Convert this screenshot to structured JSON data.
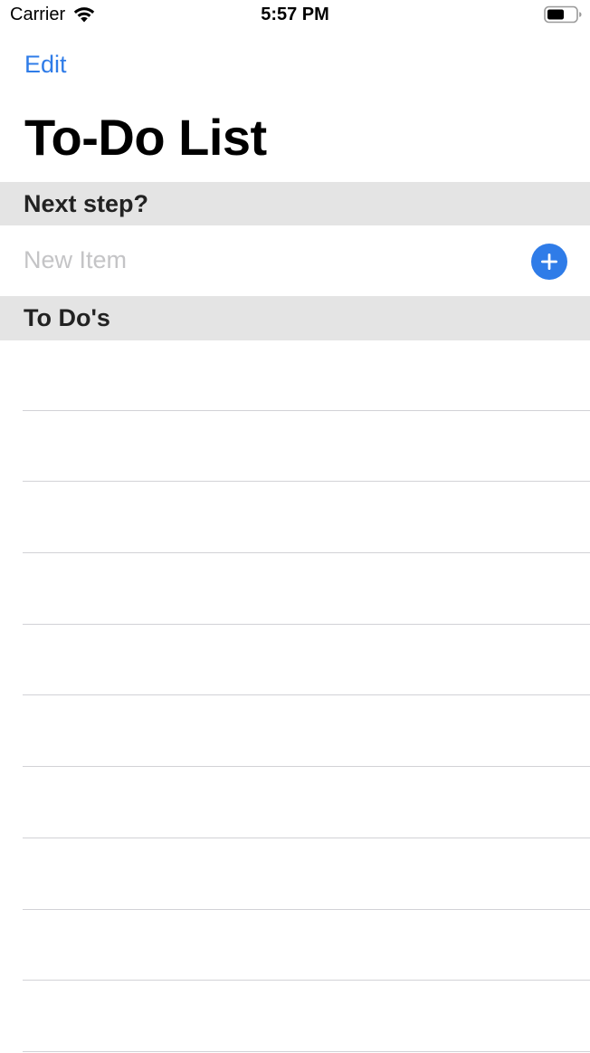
{
  "status_bar": {
    "carrier": "Carrier",
    "time": "5:57 PM",
    "wifi_icon": "wifi-icon",
    "battery_icon": "battery-icon"
  },
  "nav": {
    "edit_label": "Edit",
    "title": "To-Do List"
  },
  "sections": {
    "next_step": {
      "header": "Next step?",
      "input_placeholder": "New Item",
      "input_value": "",
      "add_icon": "plus-circle-icon"
    },
    "todos": {
      "header": "To Do's",
      "items": [
        "",
        "",
        "",
        "",
        "",
        "",
        "",
        "",
        "",
        ""
      ]
    }
  },
  "colors": {
    "accent": "#2f7ce8",
    "section_header_bg": "#e4e4e4",
    "separator": "#d2d2d6",
    "placeholder": "#c4c4c6"
  }
}
